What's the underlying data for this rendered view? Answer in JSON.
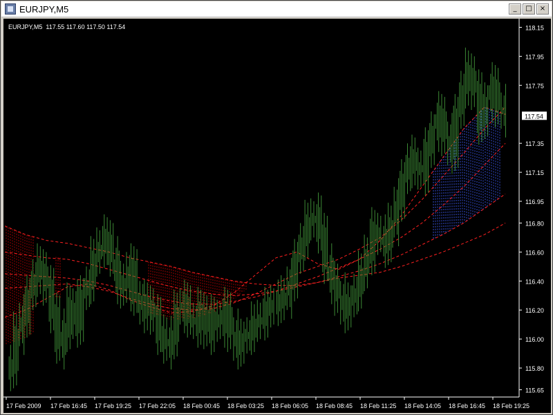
{
  "window": {
    "title": "EURJPY,M5",
    "buttons": {
      "minimize": "_",
      "maximize": "□",
      "close": "×"
    }
  },
  "chart_header": "EURJPY,M5  117.55 117.60 117.50 117.54",
  "colors": {
    "background": "#000000",
    "candles": "#3c8a35",
    "ma_lines": "#ff2020",
    "fill_red": "#c00000",
    "fill_blue": "#4060ff",
    "axis_text": "#ffffff"
  },
  "chart_data": {
    "type": "line",
    "symbol": "EURJPY",
    "timeframe": "M5",
    "ohlc_last": {
      "open": 117.55,
      "high": 117.6,
      "low": 117.5,
      "close": 117.54
    },
    "current_price_label": "117.54",
    "y_ticks": [
      "118.15",
      "117.95",
      "117.75",
      "117.54",
      "117.35",
      "117.15",
      "116.95",
      "116.80",
      "116.60",
      "116.40",
      "116.20",
      "116.00",
      "115.80",
      "115.65"
    ],
    "x_ticks": [
      "17 Feb 2009",
      "17 Feb 16:45",
      "17 Feb 19:25",
      "17 Feb 22:05",
      "18 Feb 00:45",
      "18 Feb 03:25",
      "18 Feb 06:05",
      "18 Feb 08:45",
      "18 Feb 11:25",
      "18 Feb 14:05",
      "18 Feb 16:45",
      "18 Feb 19:25"
    ],
    "ylim": [
      115.6,
      118.2
    ],
    "price_series": [
      115.8,
      116.05,
      116.15,
      116.3,
      116.45,
      116.5,
      116.35,
      116.2,
      115.95,
      116.05,
      116.25,
      116.1,
      116.3,
      116.4,
      116.55,
      116.65,
      116.7,
      116.55,
      116.4,
      116.35,
      116.5,
      116.3,
      116.2,
      116.25,
      116.15,
      116.05,
      115.95,
      116.0,
      116.2,
      116.25,
      116.15,
      116.1,
      116.2,
      116.05,
      116.15,
      116.1,
      116.2,
      116.05,
      115.95,
      116.0,
      116.05,
      116.1,
      116.15,
      116.2,
      116.25,
      116.25,
      116.3,
      116.4,
      116.55,
      116.7,
      116.8,
      116.85,
      116.75,
      116.5,
      116.4,
      116.3,
      116.2,
      116.25,
      116.35,
      116.45,
      116.6,
      116.75,
      116.7,
      116.65,
      116.8,
      116.95,
      117.1,
      117.25,
      117.2,
      117.15,
      117.3,
      117.45,
      117.55,
      117.4,
      117.3,
      117.55,
      117.75,
      117.85,
      117.7,
      117.5,
      117.65,
      117.75,
      117.6,
      117.55
    ],
    "ma_series": [
      [
        116.78,
        116.72,
        116.68,
        116.66,
        116.63,
        116.6,
        116.56,
        116.53,
        116.5,
        116.46,
        116.43,
        116.4,
        116.38,
        116.37,
        116.37,
        116.39,
        116.42,
        116.44,
        116.46,
        116.5,
        116.55,
        116.6,
        116.66,
        116.72,
        116.8
      ],
      [
        116.6,
        116.58,
        116.56,
        116.55,
        116.52,
        116.48,
        116.44,
        116.4,
        116.36,
        116.33,
        116.31,
        116.3,
        116.31,
        116.33,
        116.36,
        116.39,
        116.43,
        116.47,
        116.52,
        116.58,
        116.65,
        116.72,
        116.8,
        116.9,
        117.0
      ],
      [
        116.45,
        116.44,
        116.43,
        116.42,
        116.4,
        116.37,
        116.33,
        116.29,
        116.26,
        116.24,
        116.24,
        116.26,
        116.29,
        116.33,
        116.38,
        116.43,
        116.49,
        116.55,
        116.62,
        116.7,
        116.8,
        116.92,
        117.05,
        117.2,
        117.35
      ],
      [
        116.35,
        116.36,
        116.37,
        116.38,
        116.36,
        116.33,
        116.28,
        116.24,
        116.21,
        116.2,
        116.21,
        116.25,
        116.31,
        116.38,
        116.45,
        116.5,
        116.55,
        116.62,
        116.7,
        116.82,
        116.96,
        117.12,
        117.28,
        117.45,
        117.6
      ],
      [
        116.15,
        116.2,
        116.28,
        116.36,
        116.38,
        116.34,
        116.27,
        116.22,
        116.18,
        116.19,
        116.23,
        116.32,
        116.44,
        116.56,
        116.6,
        116.52,
        116.48,
        116.55,
        116.68,
        116.85,
        117.05,
        117.25,
        117.45,
        117.6,
        117.55
      ]
    ]
  }
}
